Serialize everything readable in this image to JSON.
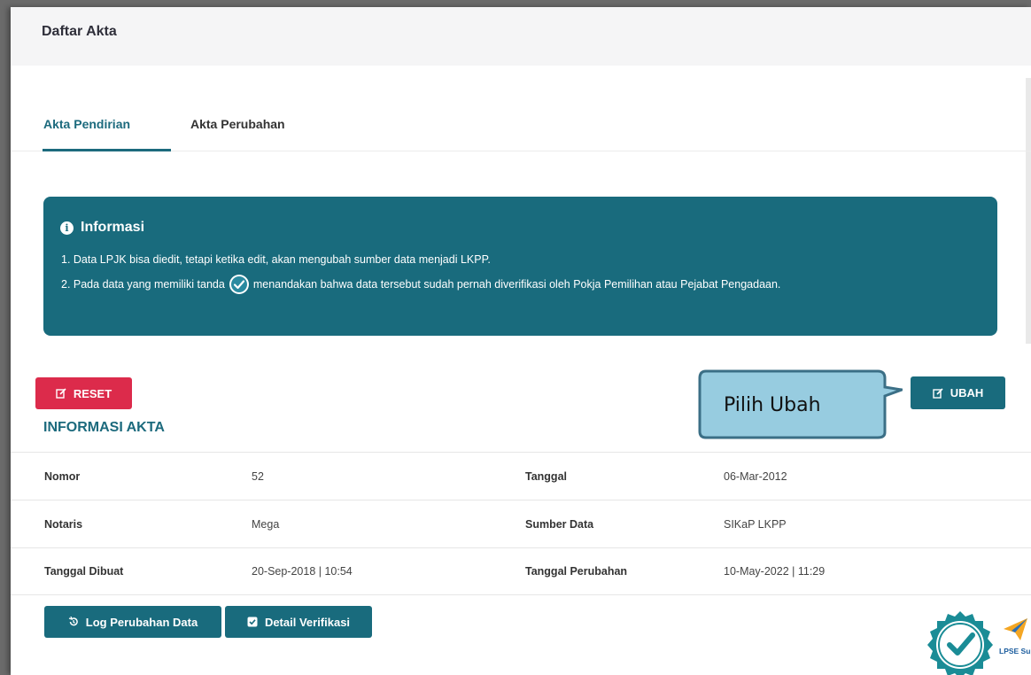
{
  "header": {
    "title": "Daftar Akta"
  },
  "tabs": [
    {
      "label": "Akta Pendirian",
      "active": true
    },
    {
      "label": "Akta Perubahan",
      "active": false
    }
  ],
  "info": {
    "title": "Informasi",
    "line1": "1. Data LPJK bisa diedit, tetapi ketika edit, akan mengubah sumber data menjadi LKPP.",
    "line2_before": "2. Pada data yang memiliki tanda",
    "line2_after": "menandakan bahwa data tersebut sudah pernah diverifikasi oleh Pokja Pemilihan atau Pejabat Pengadaan.",
    "icon": "check-circle-icon"
  },
  "buttons": {
    "reset": "RESET",
    "ubah": "UBAH",
    "log": "Log Perubahan Data",
    "detail": "Detail Verifikasi"
  },
  "callout": {
    "text": "Pilih Ubah"
  },
  "section": {
    "title": "INFORMASI AKTA"
  },
  "table": {
    "rows": [
      {
        "l1": "Nomor",
        "v1": "52",
        "l2": "Tanggal",
        "v2": "06-Mar-2012"
      },
      {
        "l1": "Notaris",
        "v1": "Mega",
        "l2": "Sumber Data",
        "v2": "SIKaP LKPP"
      },
      {
        "l1": "Tanggal Dibuat",
        "v1": "20-Sep-2018 | 10:54",
        "l2": "Tanggal Perubahan",
        "v2": "10-May-2022 | 11:29"
      }
    ]
  },
  "badges": {
    "lpse": "LPSE Support"
  },
  "colors": {
    "primary": "#196b7d",
    "danger": "#dc2b4b",
    "callout": "#97cce0"
  }
}
